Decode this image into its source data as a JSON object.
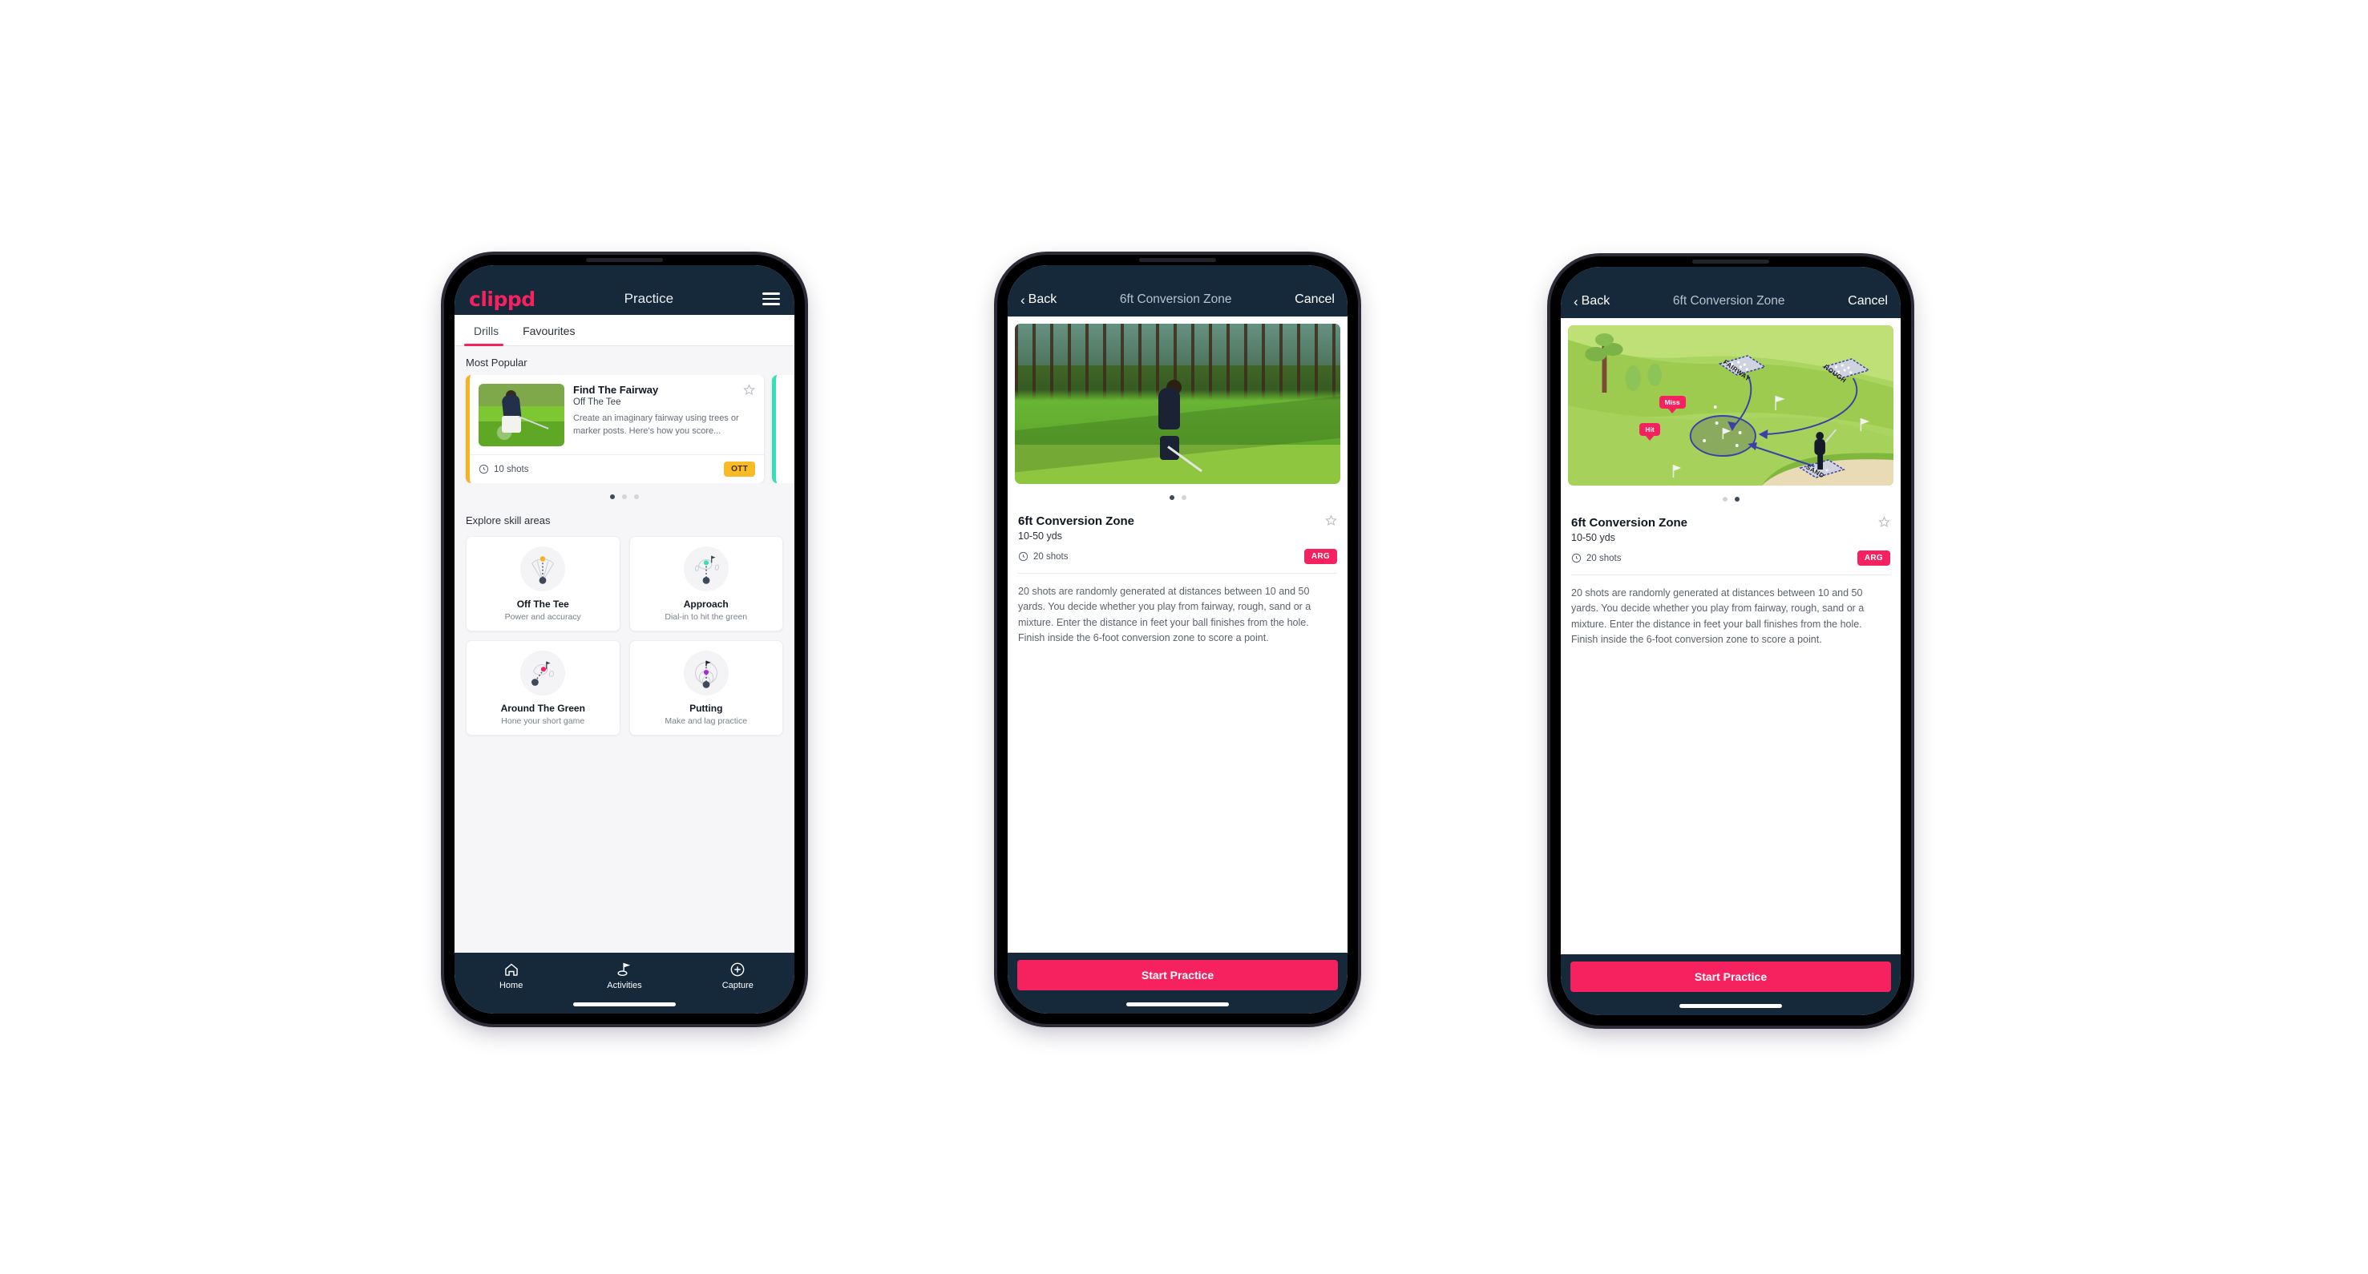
{
  "colors": {
    "brand_pink": "#f6215f",
    "nav_dark": "#16293a",
    "badge_amber": "#f9bb25",
    "accent_teal": "#35e0b4"
  },
  "phone1": {
    "appbar": {
      "logo": "clippd",
      "title": "Practice",
      "menu_icon": "hamburger-icon"
    },
    "tabs": [
      {
        "label": "Drills",
        "active": true
      },
      {
        "label": "Favourites",
        "active": false
      }
    ],
    "most_popular": {
      "section_title": "Most Popular",
      "card": {
        "title": "Find The Fairway",
        "subtitle": "Off The Tee",
        "description": "Create an imaginary fairway using trees or marker posts. Here's how you score...",
        "shots": "10 shots",
        "badge": "OTT",
        "star_icon": "star-outline-icon",
        "clock_icon": "clock-icon"
      },
      "dots": [
        true,
        false,
        false
      ]
    },
    "skill_section": {
      "title": "Explore skill areas",
      "items": [
        {
          "name": "Off The Tee",
          "desc": "Power and accuracy",
          "icon": "tee-fan-icon"
        },
        {
          "name": "Approach",
          "desc": "Dial-in to hit the green",
          "icon": "approach-green-icon"
        },
        {
          "name": "Around The Green",
          "desc": "Hone your short game",
          "icon": "around-green-icon"
        },
        {
          "name": "Putting",
          "desc": "Make and lag practice",
          "icon": "putting-rings-icon"
        }
      ]
    },
    "bottom_nav": [
      {
        "label": "Home",
        "icon": "home-icon",
        "active": false
      },
      {
        "label": "Activities",
        "icon": "golf-flag-icon",
        "active": true
      },
      {
        "label": "Capture",
        "icon": "plus-circle-icon",
        "active": false
      }
    ]
  },
  "phone2": {
    "nav": {
      "back": "Back",
      "title": "6ft Conversion Zone",
      "cancel": "Cancel",
      "back_icon": "chevron-left-icon"
    },
    "media": {
      "type": "photo",
      "alt": "golfer-chipping-photo"
    },
    "dots": [
      true,
      false
    ],
    "detail": {
      "title": "6ft Conversion Zone",
      "yards": "10-50 yds",
      "shots": "20 shots",
      "badge": "ARG",
      "star_icon": "star-outline-icon",
      "clock_icon": "clock-icon",
      "description": "20 shots are randomly generated at distances between 10 and 50 yards. You decide whether you play from fairway, rough, sand or a mixture. Enter the distance in feet your ball finishes from the hole. Finish inside the 6-foot conversion zone to score a point."
    },
    "cta": "Start Practice"
  },
  "phone3": {
    "nav": {
      "back": "Back",
      "title": "6ft Conversion Zone",
      "cancel": "Cancel",
      "back_icon": "chevron-left-icon"
    },
    "media": {
      "type": "illustration",
      "alt": "golf-course-diagram",
      "labels": [
        "FAIRWAY",
        "ROUGH",
        "SAND"
      ],
      "pins": [
        "Miss",
        "Hit"
      ]
    },
    "dots": [
      false,
      true
    ],
    "detail": {
      "title": "6ft Conversion Zone",
      "yards": "10-50 yds",
      "shots": "20 shots",
      "badge": "ARG",
      "star_icon": "star-outline-icon",
      "clock_icon": "clock-icon",
      "description": "20 shots are randomly generated at distances between 10 and 50 yards. You decide whether you play from fairway, rough, sand or a mixture. Enter the distance in feet your ball finishes from the hole. Finish inside the 6-foot conversion zone to score a point."
    },
    "cta": "Start Practice"
  }
}
